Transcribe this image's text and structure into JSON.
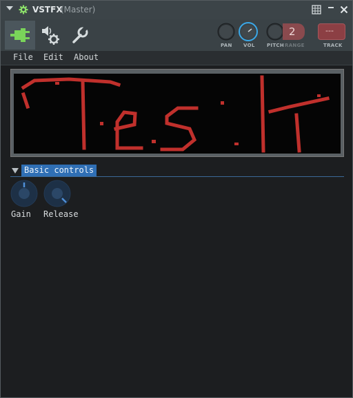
{
  "window": {
    "title": "VSTFX",
    "subtitle": "(Master)"
  },
  "title_buttons": [
    "grid-icon",
    "minimize-icon",
    "close-icon"
  ],
  "toolbar": {
    "tools": [
      "plugin-icon",
      "settings-gear-icon",
      "wrench-icon"
    ],
    "active_tool": "plugin-icon",
    "pan_label": "PAN",
    "vol_label": "VOL",
    "pitch_label": "PITCH",
    "range_label": "RANGE",
    "range_value": "2",
    "track_label": "TRACK",
    "track_value": "---"
  },
  "menu": {
    "items": [
      "File",
      "Edit",
      "About"
    ]
  },
  "display": {
    "text": "Test",
    "color": "#c0302c"
  },
  "section": {
    "title": "Basic controls"
  },
  "params": [
    {
      "label": "Gain"
    },
    {
      "label": "Release"
    }
  ],
  "colors": {
    "accent": "#2f6fb5",
    "active_tool": "#7ad45a",
    "led": "#c0302c"
  }
}
